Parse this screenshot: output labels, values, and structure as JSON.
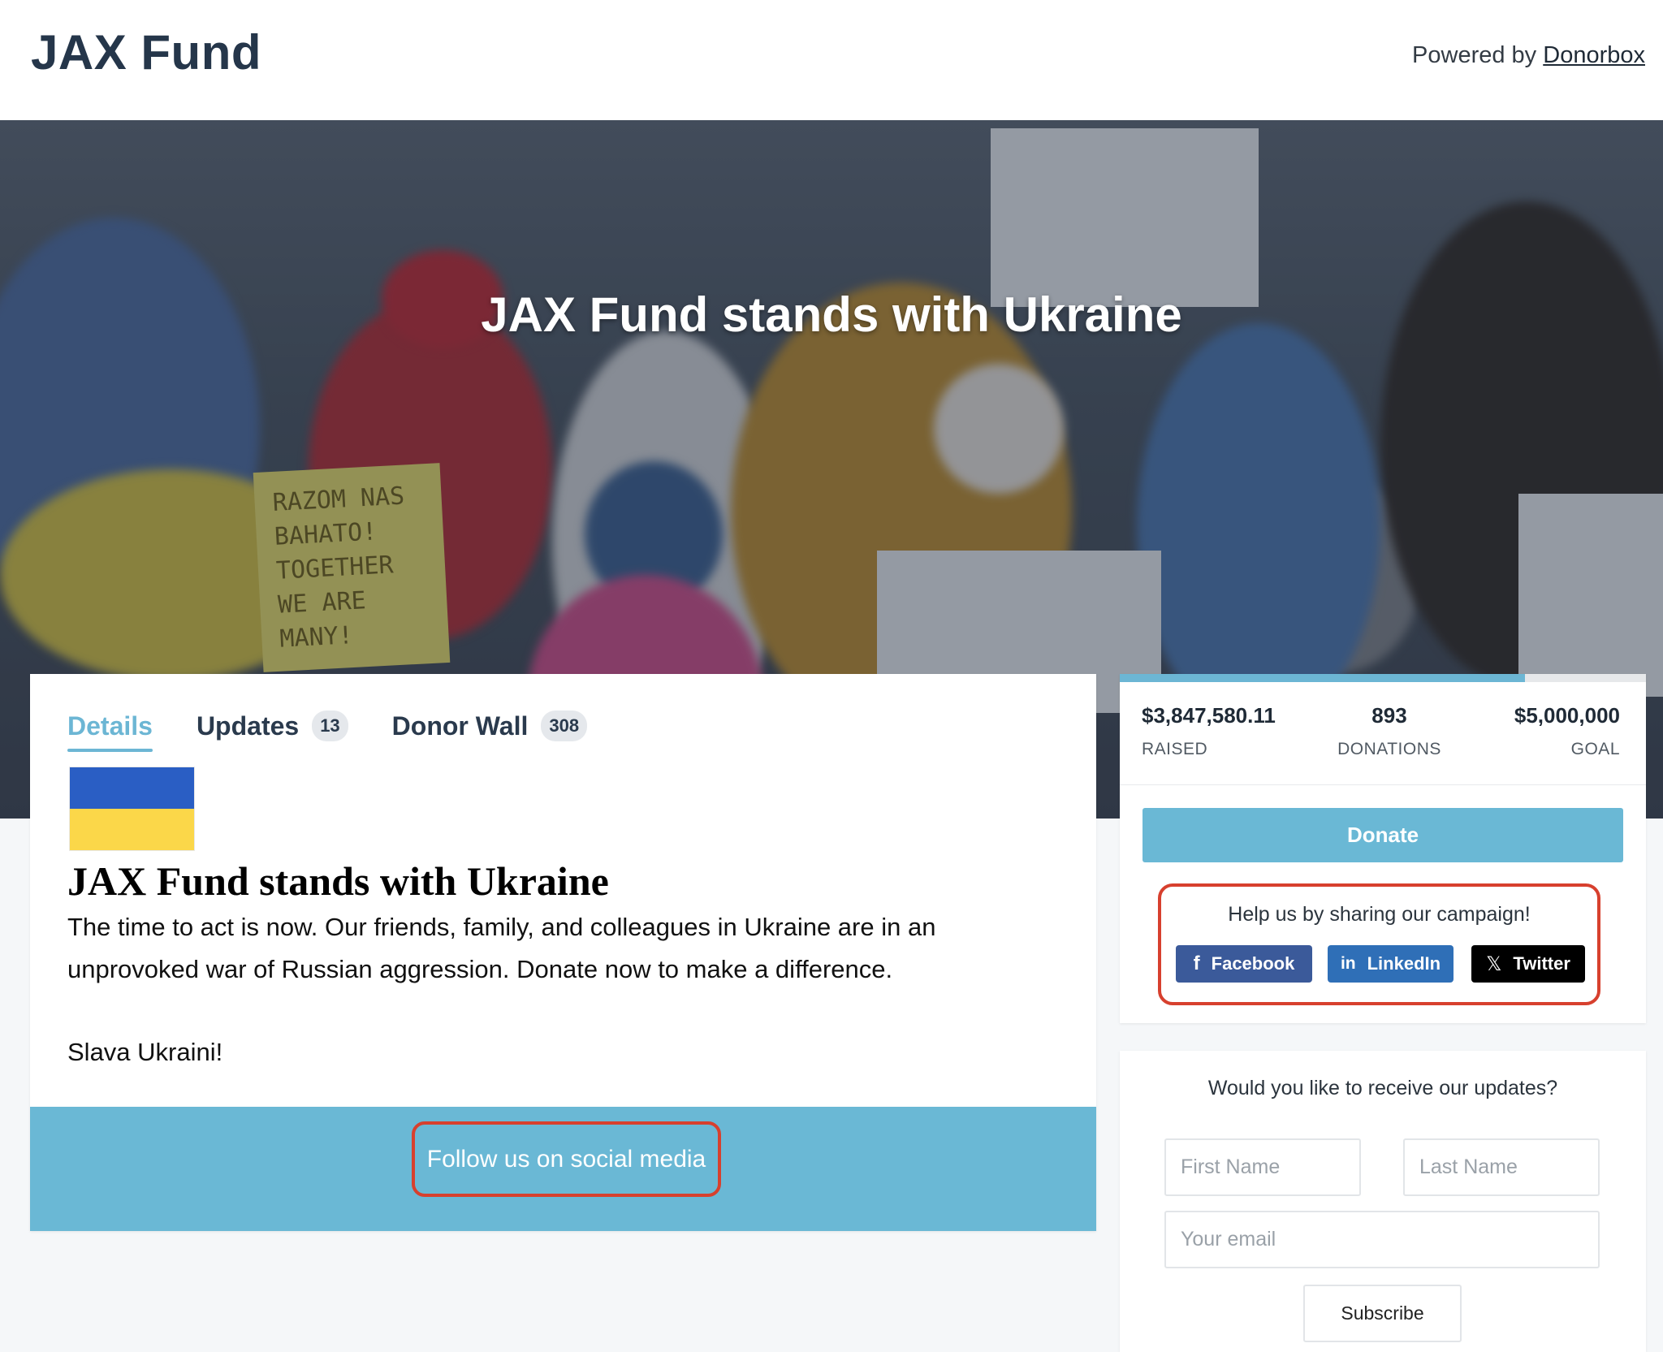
{
  "header": {
    "brand": "JAX Fund",
    "powered_prefix": "Powered by",
    "powered_link": "Donorbox"
  },
  "hero": {
    "title": "JAX Fund stands with Ukraine",
    "sign_text": "RAZOM NAS BAHATO! TOGETHER WE ARE MANY!"
  },
  "tabs": [
    {
      "label": "Details",
      "count": null,
      "active": true
    },
    {
      "label": "Updates",
      "count": "13",
      "active": false
    },
    {
      "label": "Donor Wall",
      "count": "308",
      "active": false
    }
  ],
  "content": {
    "title": "JAX Fund stands with Ukraine",
    "paragraph1": "The time to act is now. Our friends, family, and colleagues in Ukraine are in an unprovoked war of Russian aggression. Donate now to make a difference.",
    "paragraph2": "Slava Ukraini!",
    "follow_label": "Follow us on social media"
  },
  "stats": {
    "raised_value": "$3,847,580.11",
    "raised_label": "RAISED",
    "donations_value": "893",
    "donations_label": "DONATIONS",
    "goal_value": "$5,000,000",
    "goal_label": "GOAL",
    "progress_fraction": 0.77
  },
  "donate": {
    "label": "Donate"
  },
  "share": {
    "title": "Help us by sharing our campaign!",
    "buttons": [
      {
        "label": "Facebook",
        "icon": "facebook-icon",
        "color": "#3b5a9a"
      },
      {
        "label": "LinkedIn",
        "icon": "linkedin-icon",
        "color": "#2f6fb7"
      },
      {
        "label": "Twitter",
        "icon": "x-icon",
        "color": "#000000"
      }
    ]
  },
  "updates": {
    "title": "Would you like to receive our updates?",
    "first_name_placeholder": "First Name",
    "last_name_placeholder": "Last Name",
    "email_placeholder": "Your email",
    "subscribe_label": "Subscribe"
  },
  "colors": {
    "accent": "#6ab8d5",
    "highlight_border": "#d7402e",
    "ukraine_blue": "#2a5ec4",
    "ukraine_yellow": "#fbd749"
  }
}
